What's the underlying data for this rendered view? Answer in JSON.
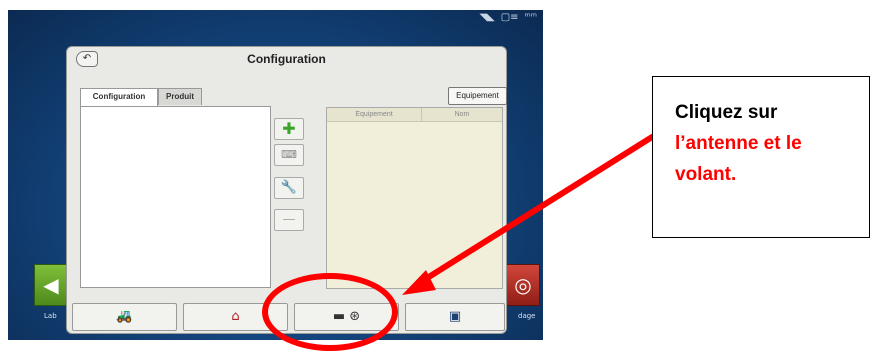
{
  "status_bar": {
    "icons": [
      "gps-antenna-icon",
      "steering-icon",
      "signal-icon"
    ],
    "glyphs": [
      "◥◣",
      "▢≡",
      "ᵐᵐ"
    ]
  },
  "background_tiles": {
    "left": {
      "label": "Lab",
      "glyph": "◀",
      "color": "#5c9a24"
    },
    "right": {
      "label": "dage",
      "glyph": "◎",
      "color": "#b5322a"
    }
  },
  "dialog": {
    "title": "Configuration",
    "back_glyph": "↶",
    "tabs": [
      {
        "label": "Configuration",
        "active": true
      },
      {
        "label": "Produit",
        "active": false
      }
    ],
    "equipment_button_label": "Equipement",
    "side_buttons": {
      "add_glyph": "✚",
      "keyboard_glyph": "⌨",
      "wrench_glyph": "🔧",
      "remove_glyph": "—"
    },
    "equipment_table": {
      "columns": [
        "Equipement",
        "Nom"
      ],
      "rows": []
    },
    "bottom_buttons": {
      "tractor_glyph": "🚜",
      "farm_glyph": "⌂",
      "guidance_glyph": "▬ ⊛",
      "display_glyph": "▣"
    }
  },
  "callout": {
    "line1": "Cliquez sur",
    "line2": "l’antenne et le",
    "line3": "volant."
  },
  "colors": {
    "annotation_red": "#ff0000",
    "screen_blue": "#124177",
    "dialog_gray": "#e9e9e6"
  }
}
